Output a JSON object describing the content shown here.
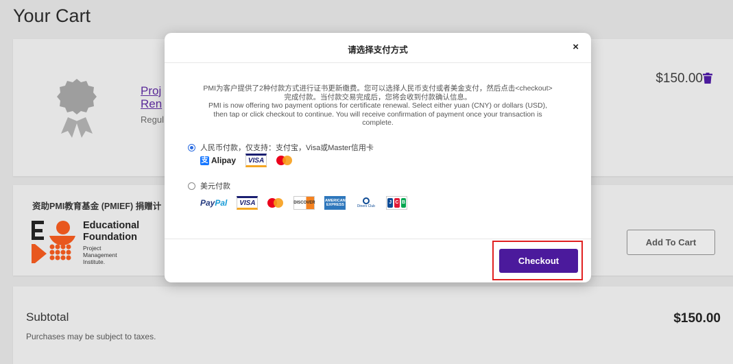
{
  "page": {
    "title": "Your Cart"
  },
  "product": {
    "link_line1": "Proj",
    "link_line2": "Ren",
    "type": "Regul",
    "price": "$150.00"
  },
  "donation": {
    "title": "资助PMI教育基金 (PMIEF) 捐赠计",
    "logo_line1": "Educational",
    "logo_line2": "Foundation",
    "logo_small1": "Project",
    "logo_small2": "Management",
    "logo_small3": "Institute.",
    "add_to_cart": "Add To Cart"
  },
  "subtotal": {
    "label": "Subtotal",
    "note": "Purchases may be subject to taxes.",
    "amount": "$150.00"
  },
  "modal": {
    "title": "请选择支付方式",
    "close": "×",
    "desc_cn_1": "PMI为客户提供了2种付款方式进行证书更新缴费。您可以选择人民币支付或者美金支付，然后点击<checkout>",
    "desc_cn_2": "完成付款。当付款交易完成后，您将会收到付款确认信息。",
    "desc_en_1": "PMI is now offering two payment options for certificate renewal. Select either yuan (CNY) or dollars (USD),",
    "desc_en_2": "then tap or click checkout to continue. You will receive confirmation of payment once your transaction is",
    "desc_en_3": "complete.",
    "option_cny": "人民币付款，仅支持：支付宝，Visa或Master信用卡",
    "option_usd": "美元付款",
    "checkout": "Checkout"
  },
  "payment_logos": {
    "alipay_mark": "支",
    "alipay": "Alipay",
    "visa": "VISA",
    "paypal_1": "Pay",
    "paypal_2": "Pal",
    "discover": "DISCOVER",
    "amex_1": "AMERICAN",
    "amex_2": "EXPRESS",
    "diners": "Diners Club",
    "jcb_j": "J",
    "jcb_c": "C",
    "jcb_b": "B"
  },
  "colors": {
    "accent_purple": "#4b1a9c",
    "highlight_red": "#e02020",
    "radio_blue": "#2a6be0"
  }
}
